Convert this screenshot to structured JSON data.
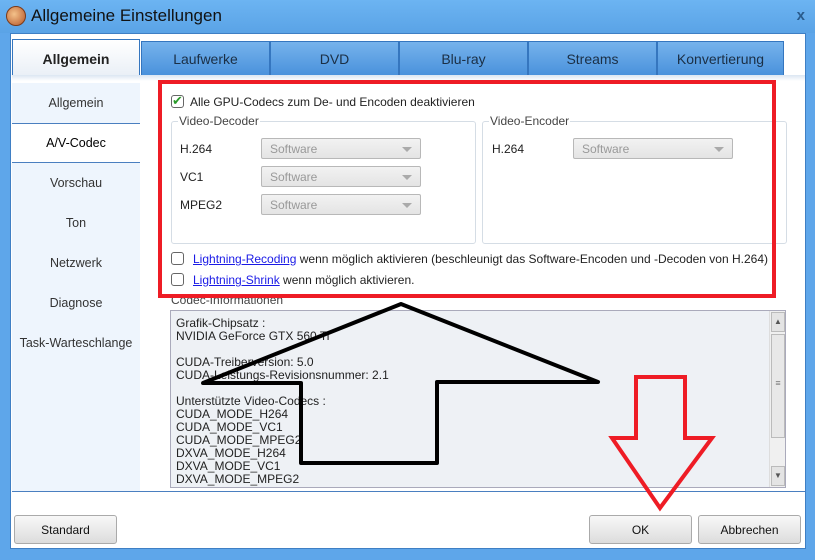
{
  "window": {
    "title": "Allgemeine Einstellungen",
    "close": "x"
  },
  "tabs": [
    "Allgemein",
    "Laufwerke",
    "DVD",
    "Blu-ray",
    "Streams",
    "Konvertierung"
  ],
  "sidebar": [
    "Allgemein",
    "A/V-Codec",
    "Vorschau",
    "Ton",
    "Netzwerk",
    "Diagnose",
    "Task-Warteschlange"
  ],
  "codec": {
    "disable_gpu": "Alle GPU-Codecs zum De- und Encoden deaktivieren",
    "decoder": {
      "title": "Video-Decoder",
      "rows": [
        {
          "label": "H.264",
          "value": "Software"
        },
        {
          "label": "VC1",
          "value": "Software"
        },
        {
          "label": "MPEG2",
          "value": "Software"
        }
      ]
    },
    "encoder": {
      "title": "Video-Encoder",
      "rows": [
        {
          "label": "H.264",
          "value": "Software"
        }
      ]
    },
    "recoding_link": "Lightning-Recoding",
    "recoding_text": " wenn möglich aktivieren (beschleunigt das Software-Encoden und -Decoden von H.264)",
    "shrink_link": "Lightning-Shrink",
    "shrink_text": " wenn möglich aktivieren."
  },
  "info": {
    "title": "Codec-Informationen",
    "lines": [
      "Grafik-Chipsatz :",
      "NVIDIA GeForce GTX 560 Ti",
      "",
      "CUDA-Treiberversion: 5.0",
      "CUDA-Leistungs-Revisionsnummer: 2.1",
      "",
      "Unterstützte Video-Codecs :",
      "CUDA_MODE_H264",
      "CUDA_MODE_VC1",
      "CUDA_MODE_MPEG2",
      "DXVA_MODE_H264",
      "DXVA_MODE_VC1",
      "DXVA_MODE_MPEG2"
    ]
  },
  "buttons": {
    "standard": "Standard",
    "ok": "OK",
    "cancel": "Abbrechen"
  },
  "colors": {
    "highlight": "#ee1c25",
    "arrow": "#000000"
  }
}
